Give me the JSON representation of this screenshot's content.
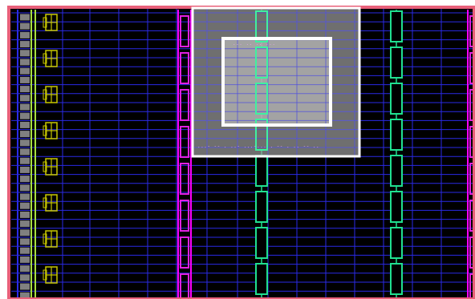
{
  "view": {
    "type": "fpga-device-floorplan",
    "colors": {
      "background": "#000000",
      "outer_border": "#e8607a",
      "grid_line": "#2a2ae6",
      "clock_region_line": "#ff00ff",
      "io_tile": "#c8c800",
      "io_pad": "#808080",
      "bram_column": "#e020e0",
      "dsp_column": "#20e090",
      "highlight_fill": "#9a9a9a",
      "selection_box": "#ffffff",
      "tiny_label": "#e6a0f0"
    }
  },
  "labels": {
    "inner_label": "... .. .. ...",
    "bottom_label": "...- -- . ..- ...-... . -- . .. -- .."
  }
}
